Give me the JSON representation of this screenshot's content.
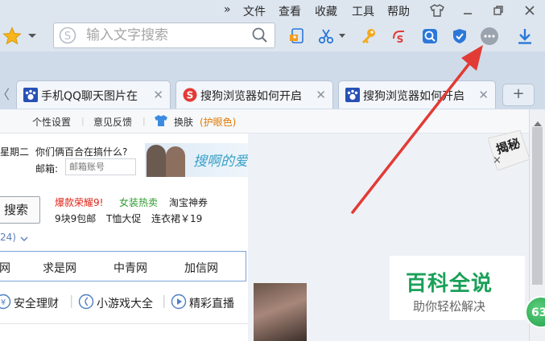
{
  "menu": {
    "chevron": "»",
    "items": [
      "文件",
      "查看",
      "收藏",
      "工具",
      "帮助"
    ]
  },
  "search": {
    "placeholder": "输入文字搜索"
  },
  "tabs": [
    {
      "title": "手机QQ聊天图片在",
      "favicon": "paw-icon"
    },
    {
      "title": "搜狗浏览器如何开启",
      "favicon": "sogou-icon"
    },
    {
      "title": "搜狗浏览器如何开启",
      "favicon": "paw-icon"
    }
  ],
  "new_tab": "+",
  "settings_bar": {
    "personal": "个性设置",
    "feedback": "意见反馈",
    "skin": "换肤",
    "eye_protect": "(护眼色)"
  },
  "panel": {
    "weekday": "星期二",
    "headline": "你们俩百合在搞什么?",
    "mail_label": "邮箱:",
    "mail_placeholder": "邮箱账号",
    "banner_text": "搜啊的爱",
    "search_btn": "搜索",
    "promo": {
      "hot": "爆款荣耀9!",
      "fashion": "女装热卖",
      "taobao": "淘宝神券",
      "nine": "9块9包邮",
      "tshirt": "T恤大促",
      "dress": "连衣裙￥19"
    },
    "count": "24)",
    "sites": [
      "网",
      "求是网",
      "中青网",
      "加信网"
    ],
    "services": [
      {
        "label": "安全理财",
        "icon": "yen-icon"
      },
      {
        "label": "小游戏大全",
        "icon": "moon-icon"
      },
      {
        "label": "精彩直播",
        "icon": "play-icon"
      }
    ]
  },
  "reveal_badge": "揭秘",
  "reveal_close": "×",
  "watermark": {
    "title": "百科全说",
    "subtitle": "助你轻松解决"
  },
  "float_badge": "63",
  "colors": {
    "accent_blue": "#2b78d8",
    "promo_red": "#e0261b",
    "promo_green": "#2d9b2d",
    "eye_orange": "#e07a00",
    "arrow_red": "#e23a34",
    "baike_green": "#1aa058"
  }
}
